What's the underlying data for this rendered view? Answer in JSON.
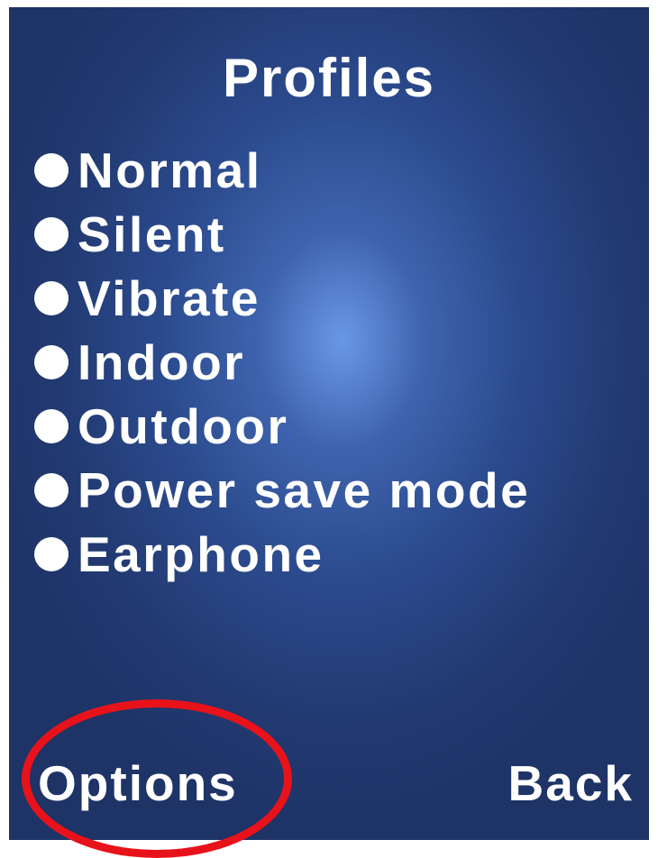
{
  "screen": {
    "title": "Profiles",
    "background_colors": [
      "#6a98e6",
      "#2b4a8d",
      "#1e3366"
    ]
  },
  "menu": {
    "items": [
      {
        "label": "Normal"
      },
      {
        "label": "Silent"
      },
      {
        "label": "Vibrate"
      },
      {
        "label": "Indoor"
      },
      {
        "label": "Outdoor"
      },
      {
        "label": "Power save mode"
      },
      {
        "label": "Earphone"
      }
    ]
  },
  "softkeys": {
    "left": "Options",
    "right": "Back"
  },
  "annotation": {
    "highlight_color": "#e8121a",
    "highlighted_element": "Options"
  }
}
